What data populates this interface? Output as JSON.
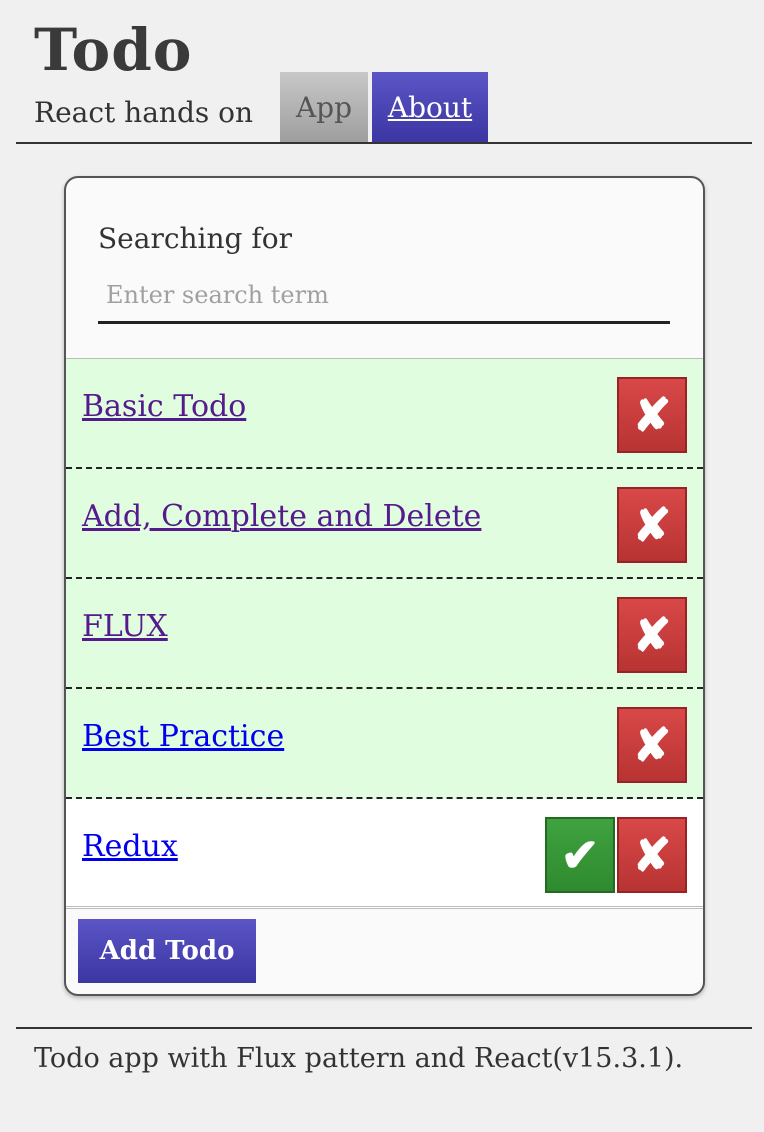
{
  "header": {
    "title": "Todo",
    "subtitle": "React hands on",
    "tabs": [
      {
        "label": "App",
        "active": false
      },
      {
        "label": "About",
        "active": true
      }
    ]
  },
  "search": {
    "label": "Searching for",
    "placeholder": "Enter search term",
    "value": ""
  },
  "todos": [
    {
      "label": "Basic Todo",
      "completed": true,
      "delete_icon": "✘"
    },
    {
      "label": "Add, Complete and Delete",
      "completed": true,
      "delete_icon": "✘"
    },
    {
      "label": "FLUX",
      "completed": true,
      "delete_icon": "✘"
    },
    {
      "label": "Best Practice",
      "completed": true,
      "delete_icon": "✘"
    },
    {
      "label": "Redux",
      "completed": false,
      "complete_icon": "✔",
      "delete_icon": "✘"
    }
  ],
  "add_button_label": "Add Todo",
  "footer_text": "Todo app with Flux pattern and React(v15.3.1).",
  "colors": {
    "accent": "#3b36a2",
    "completed_bg": "#e0fde0",
    "delete": "#c43c3c",
    "complete": "#3a9a3a"
  }
}
